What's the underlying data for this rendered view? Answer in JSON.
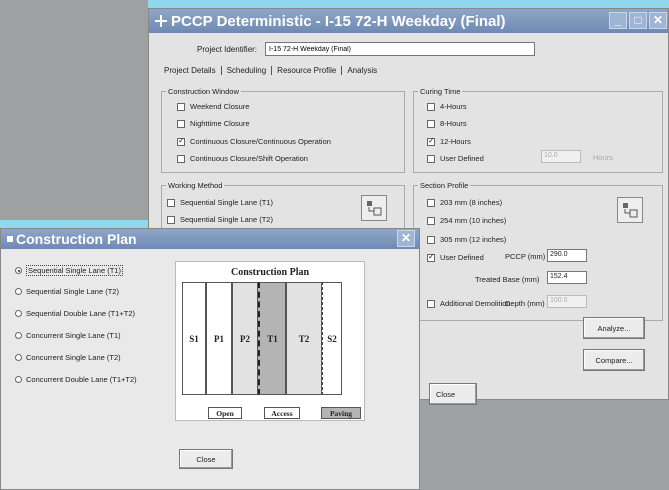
{
  "main_window": {
    "title": "PCCP Deterministic - I-15 72-H Weekday (Final)",
    "controls": [
      "_",
      "□",
      "✕"
    ],
    "project_identifier_label": "Project Identifier:",
    "project_identifier_value": "I-15 72-H Weekday (Final)",
    "tabs": [
      "Project Details",
      "Scheduling",
      "Resource Profile",
      "Analysis"
    ],
    "construction_window": {
      "label": "Construction Window",
      "options": [
        {
          "label": "Weekend Closure",
          "checked": false
        },
        {
          "label": "Nighttime Closure",
          "checked": false
        },
        {
          "label": "Continuous Closure/Continuous Operation",
          "checked": true
        },
        {
          "label": "Continuous Closure/Shift Operation",
          "checked": false
        }
      ]
    },
    "curing_time": {
      "label": "Curing Time",
      "options": [
        {
          "label": "4-Hours",
          "checked": false
        },
        {
          "label": "8-Hours",
          "checked": false
        },
        {
          "label": "12-Hours",
          "checked": true
        },
        {
          "label": "User Defined",
          "checked": false
        }
      ],
      "user_value": "10.0",
      "unit": "Hours"
    },
    "working_method": {
      "label": "Working Method",
      "options": [
        {
          "label": "Sequential Single Lane (T1)",
          "checked": false
        },
        {
          "label": "Sequential Single Lane (T2)",
          "checked": false
        }
      ]
    },
    "section_profile": {
      "label": "Section Profile",
      "options": [
        {
          "label": "203 mm (8 inches)",
          "checked": false
        },
        {
          "label": "254 mm (10 inches)",
          "checked": false
        },
        {
          "label": "305 mm (12 inches)",
          "checked": false
        },
        {
          "label": "User Defined",
          "checked": true
        },
        {
          "label": "Additional Demolition",
          "checked": false
        }
      ],
      "pccp_label": "PCCP (mm)",
      "pccp_value": "290.0",
      "base_label": "Treated Base (mm)",
      "base_value": "152.4",
      "depth_label": "Depth (mm)",
      "depth_value": "100.0"
    },
    "analyze_button": "Analyze...",
    "compare_button": "Compare...",
    "close_button": "Close"
  },
  "plan_window": {
    "title": "Construction Plan",
    "close_icon": "✕",
    "options": [
      {
        "label": "Sequential Single Lane (T1)",
        "selected": true
      },
      {
        "label": "Sequential Single Lane (T2)",
        "selected": false
      },
      {
        "label": "Sequential Double Lane (T1+T2)",
        "selected": false
      },
      {
        "label": "Concurrent Single Lane (T1)",
        "selected": false
      },
      {
        "label": "Concurrent Single Lane (T2)",
        "selected": false
      },
      {
        "label": "Concurrent Double Lane (T1+T2)",
        "selected": false
      }
    ],
    "diagram": {
      "title": "Construction Plan",
      "lanes": [
        "S1",
        "P1",
        "P2",
        "T1",
        "T2",
        "S2"
      ],
      "legend": [
        "Open",
        "Access",
        "Paving"
      ]
    },
    "close_button": "Close"
  },
  "colors": {
    "desktop": "#8fd8f0",
    "titlebar": "#7a94bb",
    "paving_lane": "#b4b4b4",
    "access_lane": "#e2e2e2"
  }
}
